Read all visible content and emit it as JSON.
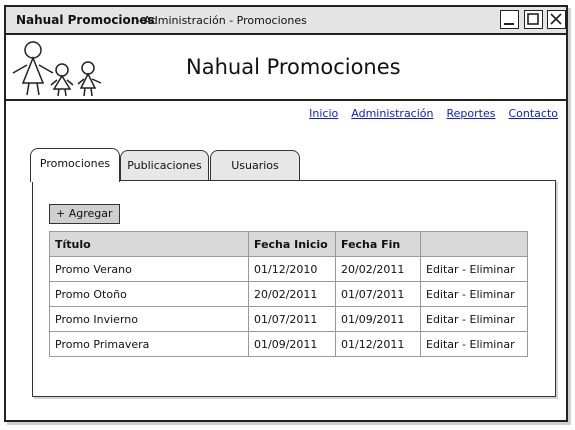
{
  "window": {
    "app_name": "Nahual Promociones",
    "subtitle": "- Administración - Promociones"
  },
  "header": {
    "brand_title": "Nahual Promociones"
  },
  "nav": {
    "items": [
      "Inicio",
      "Administración",
      "Reportes",
      "Contacto"
    ]
  },
  "tabs": {
    "items": [
      "Promociones",
      "Publicaciones",
      "Usuarios"
    ],
    "active": "Promociones"
  },
  "toolbar": {
    "add_label": "+ Agregar"
  },
  "table": {
    "headers": [
      "Título",
      "Fecha Inicio",
      "Fecha Fin",
      ""
    ],
    "action_label": "Editar - Eliminar",
    "rows": [
      [
        "Promo Verano",
        "01/12/2010",
        "20/02/2011"
      ],
      [
        "Promo Otoño",
        "20/02/2011",
        "01/07/2011"
      ],
      [
        "Promo Invierno",
        "01/07/2011",
        "01/09/2011"
      ],
      [
        "Promo Primavera",
        "01/09/2011",
        "01/12/2011"
      ]
    ]
  },
  "icons": {
    "minimize": "minimize-icon",
    "maximize": "maximize-icon",
    "close": "close-icon",
    "logo": "family-logo-icon"
  },
  "colors": {
    "link": "#0a1fd6",
    "titlebar": "#e4e4e4",
    "button": "#cfcfcf",
    "table_header": "#d9d9d9"
  }
}
